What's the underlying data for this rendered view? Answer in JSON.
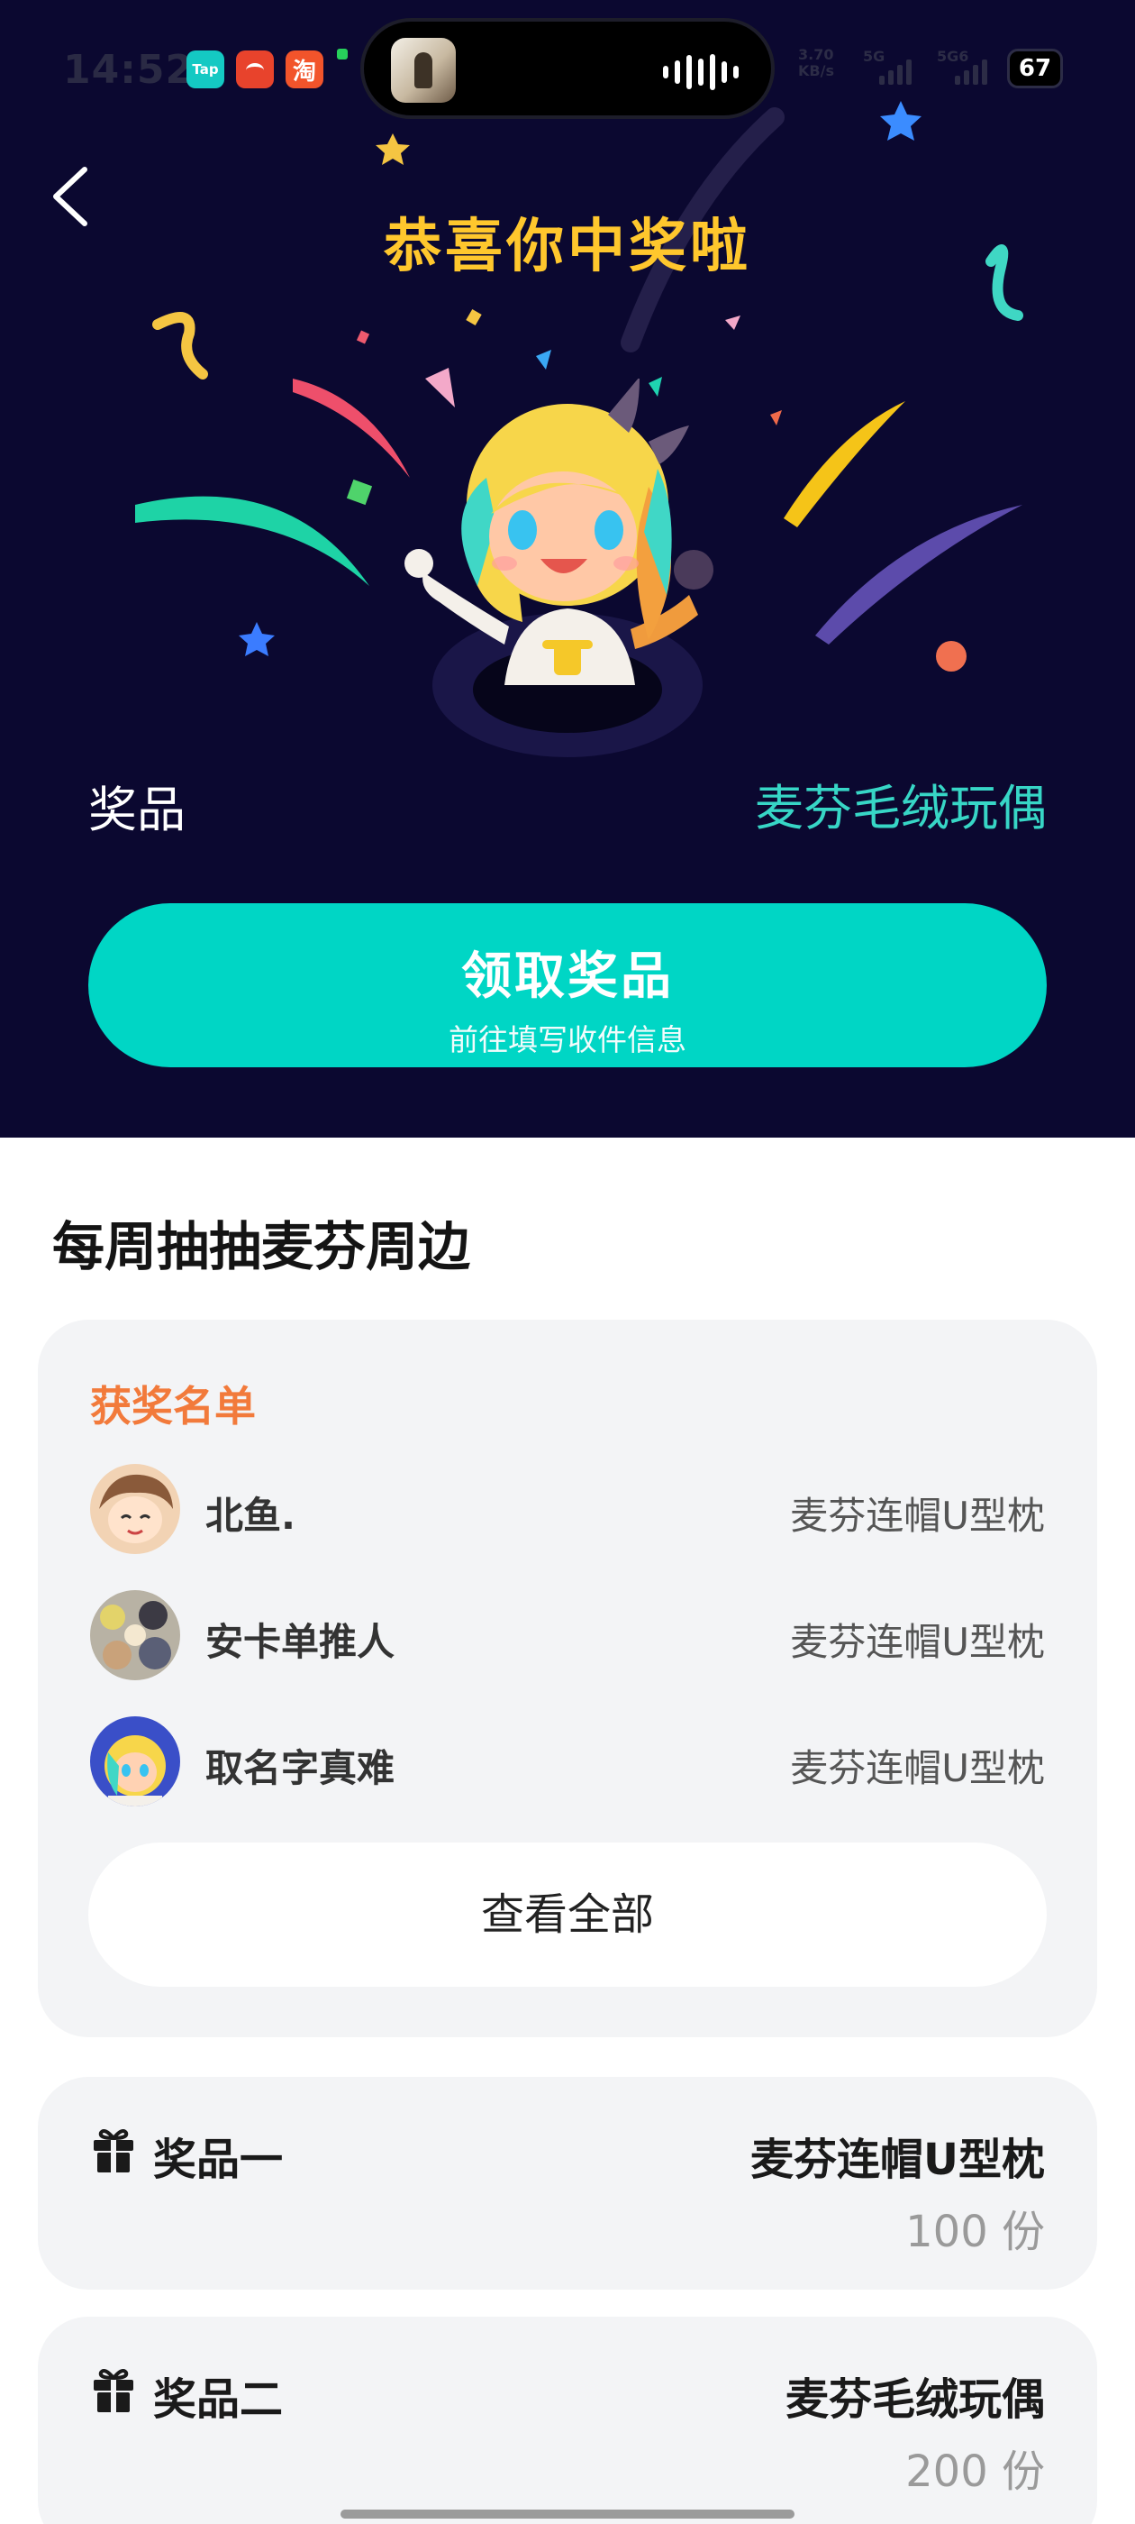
{
  "status_bar": {
    "time": "14:52",
    "app_tap_label": "Tap",
    "app_tao_label": "淘",
    "net_speed": "3.70",
    "net_unit": "KB/s",
    "network_1": "5G",
    "network_2": "5G6",
    "battery": "67"
  },
  "hero": {
    "title": "恭喜你中奖啦",
    "prize_label": "奖品",
    "prize_name": "麦芬毛绒玩偶",
    "claim_button_main": "领取奖品",
    "claim_button_sub": "前往填写收件信息"
  },
  "section": {
    "title": "每周抽抽麦芬周边"
  },
  "winners": {
    "title": "获奖名单",
    "rows": [
      {
        "name": "北鱼.",
        "prize": "麦芬连帽U型枕"
      },
      {
        "name": "安卡单推人",
        "prize": "麦芬连帽U型枕"
      },
      {
        "name": "取名字真难",
        "prize": "麦芬连帽U型枕"
      }
    ],
    "view_all": "查看全部"
  },
  "prizes": [
    {
      "rank": "奖品一",
      "item": "麦芬连帽U型枕",
      "quantity": "100 份"
    },
    {
      "rank": "奖品二",
      "item": "麦芬毛绒玩偶",
      "quantity": "200 份"
    }
  ],
  "colors": {
    "hero_bg": "#0b0830",
    "title_yellow": "#ffc72d",
    "accent_teal": "#00d6c5",
    "winners_orange": "#f27a3b"
  }
}
